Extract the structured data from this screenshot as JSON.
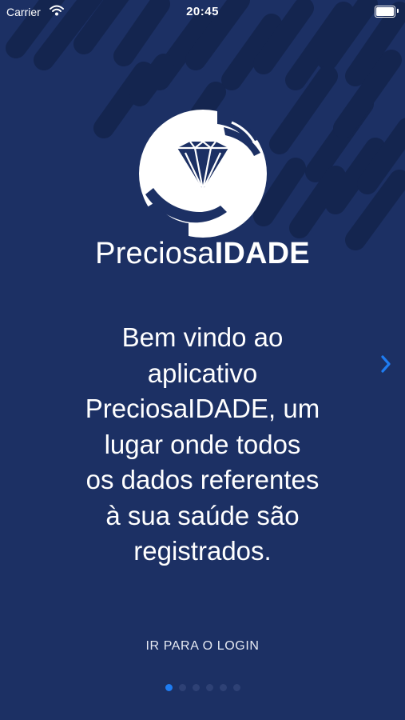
{
  "status_bar": {
    "carrier": "Carrier",
    "time": "20:45"
  },
  "logo": {
    "icon": "diamond-hands-logo",
    "brand_prefix": "Preciosa",
    "brand_suffix": "IDADE"
  },
  "onboarding": {
    "message_lines": [
      "Bem vindo ao",
      "aplicativo",
      "PreciosaIDADE, um",
      "lugar onde todos",
      "os dados referentes",
      "à sua saúde são",
      "registrados."
    ],
    "next_icon": "chevron-right-icon",
    "login_label": "IR PARA O LOGIN",
    "pages": 6,
    "current_page": 1
  },
  "colors": {
    "background": "#1c3064",
    "stripe": "#14254f",
    "accent": "#1e7cf2"
  }
}
